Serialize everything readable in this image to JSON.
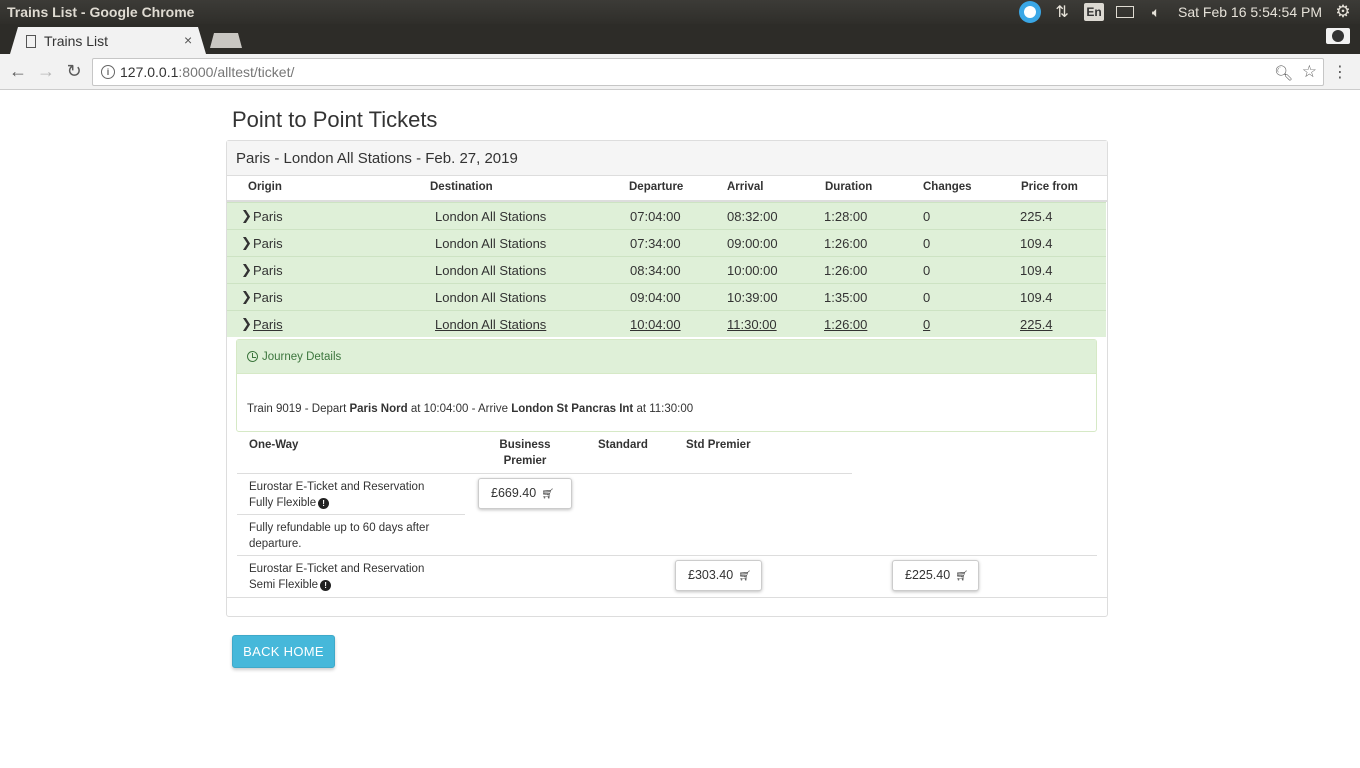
{
  "os": {
    "window_title": "Trains List - Google Chrome",
    "keyboard_layout": "En",
    "clock": "Sat Feb 16  5:54:54 PM"
  },
  "browser": {
    "tab_title": "Trains List",
    "tab_close": "×",
    "url_host": "127.0.0.1",
    "url_rest": ":8000/alltest/ticket/"
  },
  "page": {
    "title": "Point to Point Tickets",
    "panel_heading": "Paris - London All Stations - Feb. 27, 2019",
    "columns": [
      "Origin",
      "Destination",
      "Departure",
      "Arrival",
      "Duration",
      "Changes",
      "Price from"
    ],
    "trains": [
      {
        "origin": "Paris",
        "destination": "London All Stations",
        "departure": "07:04:00",
        "arrival": "08:32:00",
        "duration": "1:28:00",
        "changes": "0",
        "price": "225.4"
      },
      {
        "origin": "Paris",
        "destination": "London All Stations",
        "departure": "07:34:00",
        "arrival": "09:00:00",
        "duration": "1:26:00",
        "changes": "0",
        "price": "109.4"
      },
      {
        "origin": "Paris",
        "destination": "London All Stations",
        "departure": "08:34:00",
        "arrival": "10:00:00",
        "duration": "1:26:00",
        "changes": "0",
        "price": "109.4"
      },
      {
        "origin": "Paris",
        "destination": "London All Stations",
        "departure": "09:04:00",
        "arrival": "10:39:00",
        "duration": "1:35:00",
        "changes": "0",
        "price": "109.4"
      },
      {
        "origin": "Paris",
        "destination": "London All Stations",
        "departure": "10:04:00",
        "arrival": "11:30:00",
        "duration": "1:26:00",
        "changes": "0",
        "price": "225.4"
      }
    ],
    "journey": {
      "title": "Journey Details",
      "train_prefix": "Train 9019 - Depart ",
      "depart_station": "Paris Nord",
      "depart_mid": " at 10:04:00 - Arrive ",
      "arrive_station": "London St Pancras Int",
      "arrive_suffix": " at 11:30:00"
    },
    "fares": {
      "header_one_way": "One-Way",
      "header_business": "Business Premier",
      "header_standard": "Standard",
      "header_std_premier": "Std Premier",
      "fully_flexible_line1": "Eurostar E-Ticket and Reservation",
      "fully_flexible_line2": "Fully Flexible",
      "fully_flexible_note": "Fully refundable up to 60 days after departure.",
      "fully_flexible_business_price": "£669.40",
      "semi_flexible_line1": "Eurostar E-Ticket and Reservation",
      "semi_flexible_line2": "Semi Flexible",
      "semi_flexible_std_premier_price": "£303.40",
      "semi_flexible_extra_price": "£225.40"
    },
    "back_button": "BACK HOME"
  }
}
